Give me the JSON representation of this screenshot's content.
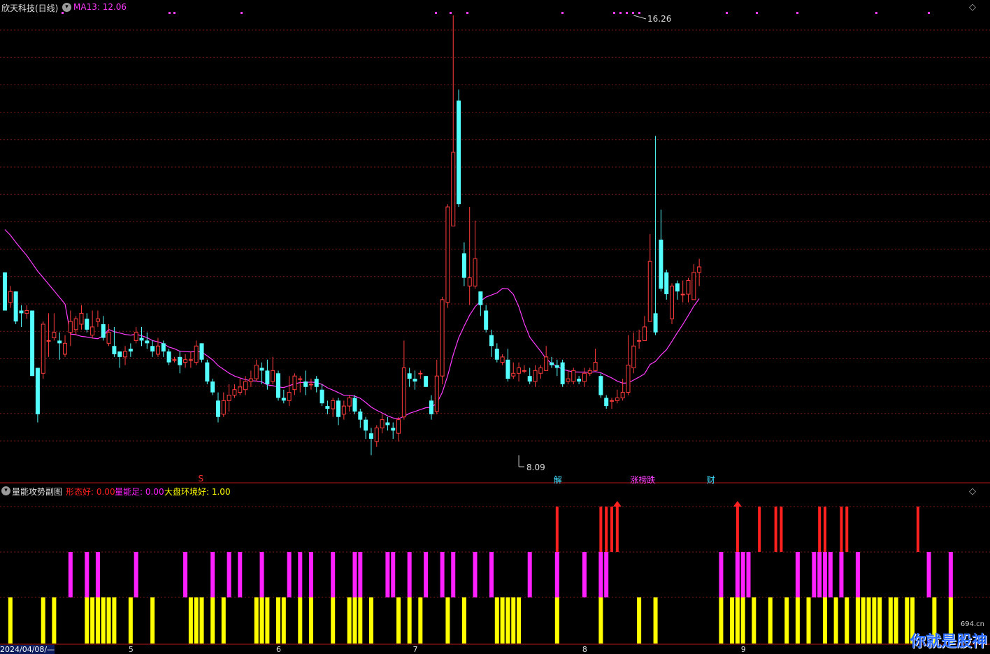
{
  "header": {
    "title": "欣天科技(日线)",
    "ma_label": "MA13: 12.06",
    "indicator_name": "量能攻势副图",
    "ind1_label": "形态好: 0.00",
    "ind2_label": "量能足: 0.00",
    "ind3_label": "大盘环境好: 1.00"
  },
  "annotations": {
    "high_label": "16.26",
    "low_label": "8.09"
  },
  "event_tags": [
    {
      "text": "S",
      "color": "#ff3030",
      "day": 36
    },
    {
      "text": "解",
      "color": "#40e0ff",
      "day": 101
    },
    {
      "text": "涨榜跌",
      "color": "#ff40ff",
      "day": 115
    },
    {
      "text": "财",
      "color": "#40e0ff",
      "day": 129
    }
  ],
  "date_axis": [
    {
      "label": "2024/04/08/—",
      "day": 0
    },
    {
      "label": "5",
      "day": 23
    },
    {
      "label": "6",
      "day": 50
    },
    {
      "label": "7",
      "day": 75
    },
    {
      "label": "8",
      "day": 106
    },
    {
      "label": "9",
      "day": 135
    }
  ],
  "logo": {
    "text": "你就是股神",
    "sub": "694.cn"
  },
  "colors": {
    "up": "#ff3c3c",
    "down": "#54ffff",
    "ma": "#ff3cff",
    "grid": "#7a1a1a",
    "divider": "#b01818",
    "title": "#e0e0e0",
    "ma_text": "#ff3cff",
    "ind1": "#ff2020",
    "ind2": "#ff20ff",
    "ind3": "#ffff00"
  },
  "chart_data": {
    "type": "candlestick",
    "price_range": [
      8.09,
      16.26
    ],
    "ma_period": 13,
    "candles": [
      [
        11.55,
        10.85,
        11.55,
        10.85
      ],
      [
        11.0,
        11.2,
        11.3,
        10.9
      ],
      [
        11.2,
        10.65,
        11.2,
        10.6
      ],
      [
        10.85,
        10.8,
        10.95,
        10.55
      ],
      [
        10.8,
        10.85,
        10.95,
        10.7
      ],
      [
        10.85,
        9.65,
        10.85,
        9.65
      ],
      [
        9.8,
        8.95,
        9.8,
        8.8
      ],
      [
        9.7,
        10.6,
        10.65,
        9.6
      ],
      [
        10.3,
        10.3,
        10.8,
        10.0
      ],
      [
        10.35,
        10.45,
        10.8,
        10.3
      ],
      [
        10.3,
        10.25,
        10.45,
        9.95
      ],
      [
        10.05,
        10.25,
        10.4,
        10.0
      ],
      [
        10.45,
        10.65,
        10.85,
        10.2
      ],
      [
        10.5,
        10.7,
        10.75,
        10.4
      ],
      [
        10.6,
        10.8,
        10.95,
        10.5
      ],
      [
        10.7,
        10.5,
        10.8,
        10.45
      ],
      [
        10.4,
        10.55,
        10.85,
        10.35
      ],
      [
        10.65,
        10.7,
        10.85,
        10.55
      ],
      [
        10.6,
        10.35,
        10.75,
        10.3
      ],
      [
        10.25,
        10.45,
        10.6,
        10.2
      ],
      [
        10.2,
        10.05,
        10.55,
        10.0
      ],
      [
        10.1,
        10.0,
        10.1,
        9.8
      ],
      [
        10.0,
        10.1,
        10.2,
        9.85
      ],
      [
        10.15,
        10.1,
        10.25,
        10.0
      ],
      [
        10.3,
        10.45,
        10.55,
        10.25
      ],
      [
        10.35,
        10.3,
        10.55,
        10.2
      ],
      [
        10.3,
        10.25,
        10.45,
        10.15
      ],
      [
        10.2,
        10.1,
        10.3,
        10.0
      ],
      [
        10.05,
        10.2,
        10.35,
        10.0
      ],
      [
        10.25,
        10.1,
        10.3,
        10.0
      ],
      [
        10.1,
        9.9,
        10.15,
        9.85
      ],
      [
        9.95,
        9.95,
        10.0,
        9.9
      ],
      [
        10.0,
        9.85,
        10.1,
        9.7
      ],
      [
        9.9,
        9.95,
        10.05,
        9.8
      ],
      [
        9.95,
        9.95,
        10.1,
        9.8
      ],
      [
        9.9,
        10.2,
        10.3,
        9.85
      ],
      [
        10.25,
        9.95,
        10.25,
        9.9
      ],
      [
        9.9,
        9.55,
        9.95,
        9.5
      ],
      [
        9.55,
        9.35,
        9.6,
        9.3
      ],
      [
        9.2,
        8.9,
        9.35,
        8.8
      ],
      [
        8.95,
        9.2,
        9.35,
        8.9
      ],
      [
        9.2,
        9.3,
        9.5,
        9.0
      ],
      [
        9.3,
        9.4,
        9.5,
        9.25
      ],
      [
        9.35,
        9.45,
        9.6,
        9.3
      ],
      [
        9.4,
        9.55,
        9.65,
        9.3
      ],
      [
        9.55,
        9.6,
        9.75,
        9.45
      ],
      [
        9.6,
        9.85,
        9.95,
        9.55
      ],
      [
        9.8,
        9.75,
        9.9,
        9.5
      ],
      [
        9.75,
        9.5,
        9.95,
        9.4
      ],
      [
        9.55,
        9.75,
        10.0,
        9.5
      ],
      [
        9.7,
        9.25,
        9.75,
        9.2
      ],
      [
        9.25,
        9.2,
        9.4,
        9.15
      ],
      [
        9.2,
        9.35,
        9.65,
        9.1
      ],
      [
        9.4,
        9.65,
        9.7,
        9.3
      ],
      [
        9.6,
        9.6,
        9.65,
        9.35
      ],
      [
        9.55,
        9.45,
        9.75,
        9.3
      ],
      [
        9.5,
        9.5,
        9.6,
        9.4
      ],
      [
        9.6,
        9.45,
        9.65,
        9.35
      ],
      [
        9.4,
        9.15,
        9.5,
        9.1
      ],
      [
        9.1,
        9.05,
        9.2,
        8.95
      ],
      [
        9.05,
        9.2,
        9.25,
        8.9
      ],
      [
        9.2,
        8.9,
        9.25,
        8.75
      ],
      [
        8.95,
        9.1,
        9.2,
        8.85
      ],
      [
        9.1,
        9.25,
        9.3,
        9.0
      ],
      [
        9.25,
        9.0,
        9.3,
        8.95
      ],
      [
        9.0,
        8.85,
        9.05,
        8.7
      ],
      [
        8.85,
        8.65,
        8.9,
        8.5
      ],
      [
        8.6,
        8.5,
        8.7,
        8.2
      ],
      [
        8.45,
        8.7,
        8.75,
        8.35
      ],
      [
        8.7,
        8.85,
        8.95,
        8.6
      ],
      [
        8.8,
        8.75,
        8.9,
        8.65
      ],
      [
        8.7,
        8.65,
        8.8,
        8.5
      ],
      [
        8.6,
        8.85,
        8.9,
        8.45
      ],
      [
        8.9,
        9.8,
        10.3,
        8.85
      ],
      [
        9.7,
        9.6,
        9.8,
        9.45
      ],
      [
        9.6,
        9.55,
        9.75,
        9.4
      ],
      [
        9.7,
        9.7,
        9.75,
        9.6
      ],
      [
        9.65,
        9.45,
        9.65,
        9.45
      ],
      [
        9.2,
        8.95,
        9.3,
        8.85
      ],
      [
        9.0,
        9.65,
        9.95,
        8.95
      ],
      [
        9.65,
        11.05,
        11.1,
        9.5
      ],
      [
        11.0,
        12.75,
        12.8,
        10.9
      ],
      [
        12.4,
        13.75,
        16.26,
        12.4
      ],
      [
        14.7,
        12.8,
        14.9,
        12.75
      ],
      [
        11.9,
        11.45,
        12.1,
        11.3
      ],
      [
        11.3,
        11.45,
        12.75,
        10.95
      ],
      [
        11.3,
        11.8,
        12.5,
        11.25
      ],
      [
        11.2,
        10.95,
        11.2,
        10.75
      ],
      [
        10.85,
        10.5,
        10.95,
        10.45
      ],
      [
        10.4,
        10.2,
        10.5,
        10.0
      ],
      [
        10.15,
        9.95,
        10.25,
        9.9
      ],
      [
        9.9,
        10.0,
        10.05,
        9.85
      ],
      [
        9.95,
        9.6,
        10.15,
        9.55
      ],
      [
        9.65,
        9.7,
        9.9,
        9.6
      ],
      [
        9.7,
        9.8,
        9.9,
        9.55
      ],
      [
        9.75,
        9.75,
        9.85,
        9.7
      ],
      [
        9.65,
        9.55,
        9.8,
        9.5
      ],
      [
        9.55,
        9.75,
        9.85,
        9.45
      ],
      [
        9.7,
        9.8,
        9.85,
        9.6
      ],
      [
        9.75,
        10.0,
        10.2,
        9.75
      ],
      [
        9.9,
        9.85,
        10.0,
        9.8
      ],
      [
        9.85,
        9.8,
        9.95,
        9.65
      ],
      [
        9.9,
        9.5,
        9.95,
        9.45
      ],
      [
        9.55,
        9.6,
        9.75,
        9.5
      ],
      [
        9.55,
        9.75,
        9.8,
        9.5
      ],
      [
        9.6,
        9.55,
        9.65,
        9.5
      ],
      [
        9.55,
        9.7,
        9.8,
        9.45
      ],
      [
        9.7,
        9.75,
        9.8,
        9.65
      ],
      [
        9.75,
        9.9,
        10.15,
        9.75
      ],
      [
        9.65,
        9.3,
        9.7,
        9.25
      ],
      [
        9.25,
        9.1,
        9.3,
        9.05
      ],
      [
        9.2,
        9.2,
        9.25,
        9.05
      ],
      [
        9.2,
        9.25,
        9.4,
        9.15
      ],
      [
        9.25,
        9.35,
        9.6,
        9.2
      ],
      [
        9.35,
        9.85,
        10.4,
        9.3
      ],
      [
        9.8,
        10.2,
        10.45,
        9.7
      ],
      [
        10.3,
        10.3,
        10.5,
        10.15
      ],
      [
        10.3,
        10.55,
        10.75,
        10.3
      ],
      [
        10.65,
        11.75,
        12.25,
        10.7
      ],
      [
        10.8,
        10.45,
        14.05,
        10.4
      ],
      [
        12.15,
        11.25,
        12.7,
        11.2
      ],
      [
        11.55,
        11.15,
        11.6,
        11.05
      ],
      [
        10.7,
        11.3,
        11.35,
        10.6
      ],
      [
        11.35,
        11.2,
        11.4,
        11.05
      ],
      [
        11.15,
        11.15,
        11.4,
        11.0
      ],
      [
        11.15,
        11.4,
        11.45,
        11.0
      ],
      [
        11.05,
        11.55,
        11.7,
        11.05
      ],
      [
        11.55,
        11.65,
        11.8,
        11.3
      ]
    ],
    "vol_red_days": [
      101,
      109,
      110,
      111,
      112,
      134,
      138,
      141,
      142,
      149,
      150,
      153,
      154,
      167
    ],
    "vol_magenta_days": [
      12,
      15,
      17,
      24,
      33,
      38,
      41,
      43,
      47,
      52,
      54,
      56,
      60,
      64,
      65,
      70,
      71,
      74,
      77,
      80,
      82,
      86,
      89,
      96,
      101,
      106,
      109,
      110,
      131,
      134,
      135,
      136,
      145,
      148,
      149,
      150,
      151,
      153,
      156,
      169,
      173
    ],
    "vol_yellow_days": [
      1,
      7,
      9,
      15,
      16,
      17,
      18,
      19,
      20,
      23,
      27,
      34,
      35,
      36,
      38,
      40,
      46,
      47,
      48,
      50,
      51,
      54,
      56,
      60,
      63,
      64,
      65,
      67,
      72,
      74,
      76,
      81,
      84,
      90,
      91,
      92,
      93,
      94,
      101,
      109,
      116,
      119,
      131,
      133,
      134,
      135,
      137,
      140,
      143,
      145,
      147,
      150,
      152,
      154,
      156,
      157,
      158,
      159,
      160,
      162,
      163,
      165,
      166,
      170,
      173
    ]
  }
}
